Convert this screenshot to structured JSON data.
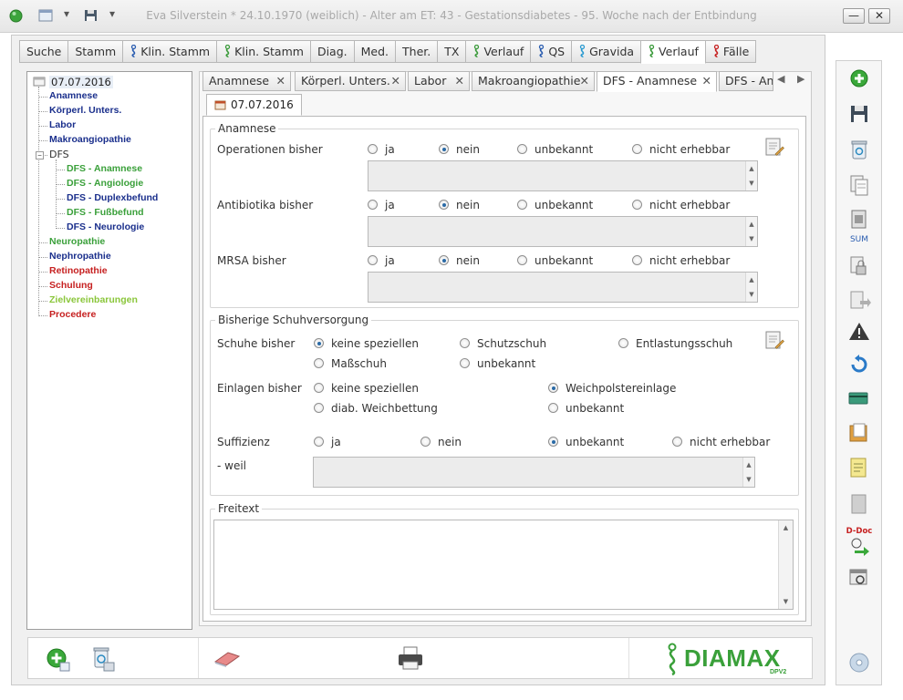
{
  "window": {
    "title": "Eva Silverstein  * 24.10.1970 (weiblich) - Alter am ET: 43 - Gestationsdiabetes - 95. Woche nach der Entbindung",
    "minimize": "—",
    "close": "✕"
  },
  "main_tabs": [
    {
      "label": "Suche"
    },
    {
      "label": "Stamm"
    },
    {
      "label": "Klin. Stamm",
      "icon": "person-icon",
      "icon_color": "#2a5db0"
    },
    {
      "label": "Klin. Stamm",
      "icon": "person-icon",
      "icon_color": "#3a9a3a"
    },
    {
      "label": "Diag."
    },
    {
      "label": "Med."
    },
    {
      "label": "Ther."
    },
    {
      "label": "TX"
    },
    {
      "label": "Verlauf",
      "icon": "person-icon",
      "icon_color": "#3a9a3a"
    },
    {
      "label": "QS",
      "icon": "person-icon",
      "icon_color": "#2a5db0"
    },
    {
      "label": "Gravida",
      "icon": "person-icon",
      "icon_color": "#2a9ad0"
    },
    {
      "label": "Verlauf",
      "icon": "person-icon",
      "icon_color": "#3a9a3a",
      "active": true
    },
    {
      "label": "Fälle",
      "icon": "person-icon",
      "icon_color": "#c62020"
    }
  ],
  "tree": {
    "root": "07.07.2016",
    "items": [
      {
        "label": "Anamnese",
        "color": "#1a2f8c"
      },
      {
        "label": "Körperl. Unters.",
        "color": "#1a2f8c"
      },
      {
        "label": "Labor",
        "color": "#1a2f8c"
      },
      {
        "label": "Makroangiopathie",
        "color": "#1a2f8c"
      },
      {
        "label": "DFS",
        "color": "#333333"
      },
      {
        "label": "DFS - Anamnese",
        "color": "#3aa03a"
      },
      {
        "label": "DFS - Angiologie",
        "color": "#3aa03a"
      },
      {
        "label": "DFS - Duplexbefund",
        "color": "#1a2f8c"
      },
      {
        "label": "DFS - Fußbefund",
        "color": "#3aa03a"
      },
      {
        "label": "DFS - Neurologie",
        "color": "#1a2f8c"
      },
      {
        "label": "Neuropathie",
        "color": "#3aa03a"
      },
      {
        "label": "Nephropathie",
        "color": "#1a2f8c"
      },
      {
        "label": "Retinopathie",
        "color": "#c62020"
      },
      {
        "label": "Schulung",
        "color": "#c62020"
      },
      {
        "label": "Zielvereinbarungen",
        "color": "#8ac63a"
      },
      {
        "label": "Procedere",
        "color": "#c62020"
      }
    ]
  },
  "inner_tabs": [
    {
      "label": "Anamnese"
    },
    {
      "label": "Körperl. Unters."
    },
    {
      "label": "Labor"
    },
    {
      "label": "Makroangiopathie"
    },
    {
      "label": "DFS - Anamnese",
      "active": true
    },
    {
      "label": "DFS - An"
    }
  ],
  "close_x": "✕",
  "date_tab": "07.07.2016",
  "anamnese": {
    "legend": "Anamnese",
    "rows": [
      {
        "label": "Operationen bisher",
        "selected": "nein"
      },
      {
        "label": "Antibiotika bisher",
        "selected": "nein"
      },
      {
        "label": "MRSA bisher",
        "selected": "nein"
      }
    ],
    "options": [
      "ja",
      "nein",
      "unbekannt",
      "nicht erhebbar"
    ]
  },
  "schuh": {
    "legend": "Bisherige Schuhversorgung",
    "schuhe_label": "Schuhe bisher",
    "schuhe_options": [
      "keine speziellen",
      "Schutzschuh",
      "Entlastungsschuh",
      "Maßschuh",
      "unbekannt"
    ],
    "schuhe_selected": "keine speziellen",
    "einlagen_label": "Einlagen bisher",
    "einlagen_options": [
      "keine speziellen",
      "Weichpolstereinlage",
      "diab. Weichbettung",
      "unbekannt"
    ],
    "einlagen_selected": "Weichpolstereinlage",
    "suffizienz_label": "Suffizienz",
    "suffizienz_options": [
      "ja",
      "nein",
      "unbekannt",
      "nicht erhebbar"
    ],
    "suffizienz_selected": "unbekannt",
    "weil_label": "- weil"
  },
  "freitext": {
    "legend": "Freitext"
  },
  "rightbar": {
    "sum_label": "SUM",
    "ddoc_label": "D-Doc"
  },
  "footer": {
    "logo_text": "DIAMAX",
    "logo_sub": "DPV2"
  },
  "colors": {
    "accent_blue": "#2a6aa6",
    "logo_green": "#3aa03a"
  }
}
